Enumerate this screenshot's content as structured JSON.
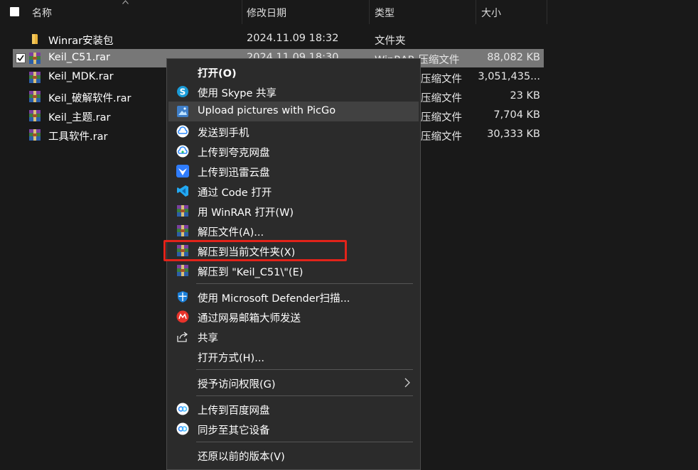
{
  "columns": {
    "name": "名称",
    "modified": "修改日期",
    "type": "类型",
    "size": "大小"
  },
  "files": [
    {
      "name": "Winrar安装包",
      "date": "2024.11.09 18:32",
      "type": "文件夹",
      "size": "",
      "icon": "folder-icon"
    },
    {
      "name": "Keil_C51.rar",
      "date": "2024.11.09 18:30",
      "type": "WinRAR 压缩文件",
      "size": "88,082 KB",
      "icon": "winrar-archive-icon",
      "selected": true
    },
    {
      "name": "Keil_MDK.rar",
      "date": "",
      "type": "压缩文件",
      "size": "3,051,435...",
      "icon": "winrar-archive-icon"
    },
    {
      "name": "Keil_破解软件.rar",
      "date": "",
      "type": "压缩文件",
      "size": "23 KB",
      "icon": "winrar-archive-icon"
    },
    {
      "name": "Keil_主题.rar",
      "date": "",
      "type": "压缩文件",
      "size": "7,704 KB",
      "icon": "winrar-archive-icon"
    },
    {
      "name": "工具软件.rar",
      "date": "",
      "type": "压缩文件",
      "size": "30,333 KB",
      "icon": "winrar-archive-icon"
    }
  ],
  "menu": {
    "items": [
      {
        "label": "打开(O)",
        "icon": "",
        "bold": true
      },
      {
        "label": "使用 Skype 共享",
        "icon": "skype-icon"
      },
      {
        "label": "Upload pictures with PicGo",
        "icon": "picgo-icon",
        "hover": true
      },
      {
        "label": "发送到手机",
        "icon": "cloud-phone-icon"
      },
      {
        "label": "上传到夸克网盘",
        "icon": "quark-cloud-icon"
      },
      {
        "label": "上传到迅雷云盘",
        "icon": "xunlei-icon"
      },
      {
        "label": "通过 Code 打开",
        "icon": "vscode-icon"
      },
      {
        "label": "用 WinRAR 打开(W)",
        "icon": "winrar-icon"
      },
      {
        "label": "解压文件(A)...",
        "icon": "winrar-icon"
      },
      {
        "label": "解压到当前文件夹(X)",
        "icon": "winrar-icon",
        "highlighted": true
      },
      {
        "label": "解压到 \"Keil_C51\\\"(E)",
        "icon": "winrar-icon"
      },
      {
        "label": "使用 Microsoft Defender扫描...",
        "icon": "defender-shield-icon"
      },
      {
        "label": "通过网易邮箱大师发送",
        "icon": "netease-mail-icon"
      },
      {
        "label": "共享",
        "icon": "share-icon"
      },
      {
        "label": "打开方式(H)...",
        "icon": ""
      },
      {
        "label": "授予访问权限(G)",
        "icon": "",
        "submenu": true
      },
      {
        "label": "上传到百度网盘",
        "icon": "baidu-cloud-icon"
      },
      {
        "label": "同步至其它设备",
        "icon": "baidu-sync-icon"
      },
      {
        "label": "还原以前的版本(V)",
        "icon": ""
      }
    ]
  },
  "colors": {
    "background": "#191919",
    "menu_bg": "#2b2b2b",
    "selected_row": "#777777",
    "highlight_box": "#e2231a"
  }
}
